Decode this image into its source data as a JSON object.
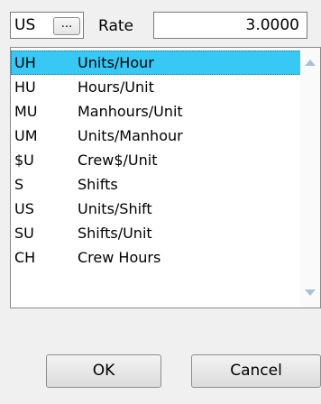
{
  "header": {
    "code_value": "US",
    "browse_label": "...",
    "rate_label": "Rate",
    "rate_value": "3.0000"
  },
  "list": {
    "selected_index": 0,
    "items": [
      {
        "code": "UH",
        "description": "Units/Hour"
      },
      {
        "code": "HU",
        "description": "Hours/Unit"
      },
      {
        "code": "MU",
        "description": "Manhours/Unit"
      },
      {
        "code": "UM",
        "description": "Units/Manhour"
      },
      {
        "code": "$U",
        "description": "Crew$/Unit"
      },
      {
        "code": "S",
        "description": "Shifts"
      },
      {
        "code": "US",
        "description": "Units/Shift"
      },
      {
        "code": "SU",
        "description": "Shifts/Unit"
      },
      {
        "code": "CH",
        "description": "Crew Hours"
      }
    ]
  },
  "buttons": {
    "ok_label": "OK",
    "cancel_label": "Cancel"
  },
  "colors": {
    "selection": "#37c8f5",
    "scroll_arrow": "#a9bfd6"
  },
  "icons": {
    "scroll_up": "triangle-up",
    "scroll_down": "triangle-down"
  }
}
